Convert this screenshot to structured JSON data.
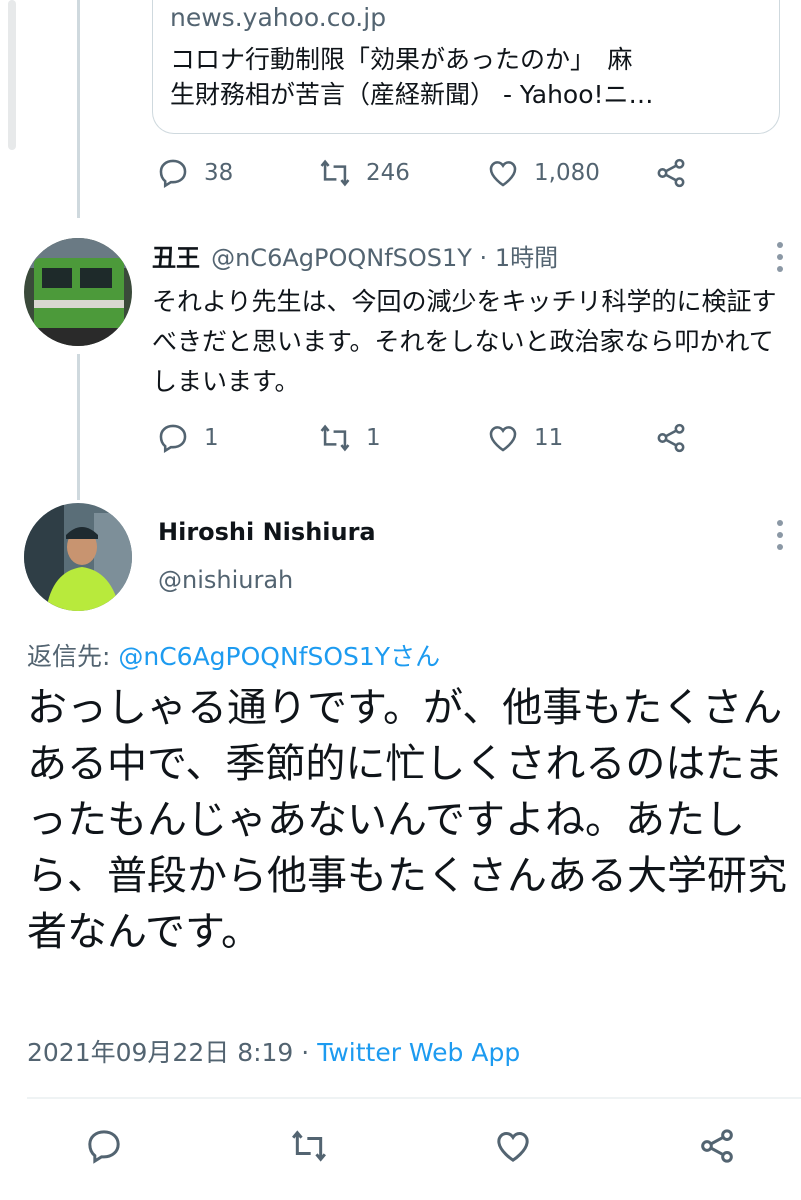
{
  "quoted_card": {
    "domain": "news.yahoo.co.jp",
    "title_line1": "コロナ行動制限「効果があったのか」　麻",
    "title_line2": "生財務相が苦言（産経新聞） - Yahoo!ニ…"
  },
  "tweet1_actions": {
    "replies": "38",
    "retweets": "246",
    "likes": "1,080"
  },
  "tweet2": {
    "name": "丑王",
    "handle_time": "@nC6AgPOQNfSOS1Y · 1時間",
    "text": "それより先生は、今回の減少をキッチリ科学的に検証すべきだと思います。それをしないと政治家なら叩かれてしまいます。",
    "replies": "1",
    "retweets": "1",
    "likes": "11"
  },
  "main_tweet": {
    "name": "Hiroshi Nishiura",
    "handle": "@nishiurah",
    "reply_prefix": "返信先: ",
    "reply_target": "@nC6AgPOQNfSOS1Yさん",
    "text": "おっしゃる通りです。が、他事もたくさんある中で、季節的に忙しくされるのはたまったもんじゃあないんですよね。あたしら、普段から他事もたくさんある大学研究者なんです。",
    "date": "2021年09月22日 8:19 · ",
    "source": "Twitter Web App"
  },
  "icons": [
    "reply-icon",
    "retweet-icon",
    "like-icon",
    "share-icon",
    "more-icon"
  ]
}
